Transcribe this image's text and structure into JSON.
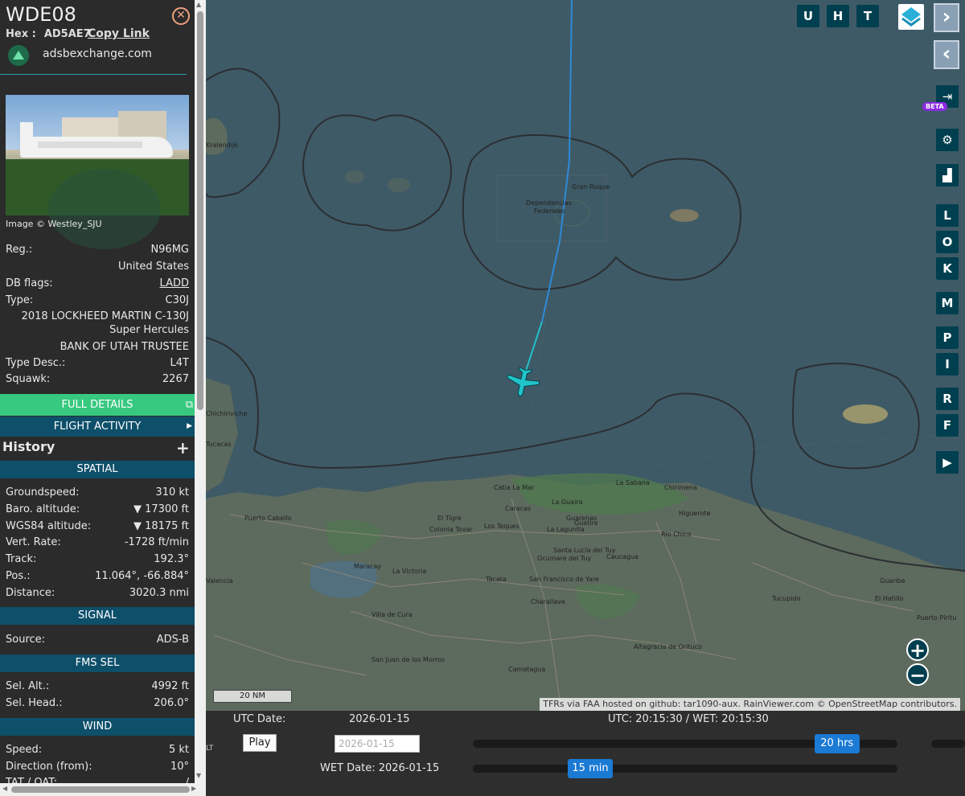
{
  "sidebar": {
    "callsign": "WDE08",
    "close_icon": "close-icon",
    "hex_label": "Hex :",
    "hex_value": "AD5AE7",
    "copy_link": "Copy Link",
    "site": "adsbexchange.com",
    "photo_caption": "Image © Westley_SJU",
    "reg_label": "Reg.:",
    "reg_value": "N96MG",
    "country": "United States",
    "dbflags_label": "DB flags:",
    "dbflags_value": "LADD",
    "type_label": "Type:",
    "type_value": "C30J",
    "type_line1": "2018 LOCKHEED MARTIN C-130J",
    "type_line2": "Super Hercules",
    "owner": "BANK OF UTAH TRUSTEE",
    "typedesc_label": "Type Desc.:",
    "typedesc_value": "L4T",
    "squawk_label": "Squawk:",
    "squawk_value": "2267",
    "full_details": "FULL DETAILS",
    "flight_activity": "FLIGHT ACTIVITY",
    "history": "History",
    "spatial_header": "SPATIAL",
    "groundspeed_label": "Groundspeed:",
    "groundspeed_value": "310 kt",
    "baro_label": "Baro. altitude:",
    "baro_value": "▼ 17300 ft",
    "wgs_label": "WGS84 altitude:",
    "wgs_value": "▼ 18175 ft",
    "vrate_label": "Vert. Rate:",
    "vrate_value": "-1728 ft/min",
    "track_label": "Track:",
    "track_value": "192.3°",
    "pos_label": "Pos.:",
    "pos_value": "11.064°, -66.884°",
    "distance_label": "Distance:",
    "distance_value": "3020.3 nmi",
    "signal_header": "SIGNAL",
    "source_label": "Source:",
    "source_value": "ADS-B",
    "fms_header": "FMS SEL",
    "selalt_label": "Sel. Alt.:",
    "selalt_value": "4992 ft",
    "selhead_label": "Sel. Head.:",
    "selhead_value": "206.0°",
    "wind_header": "WIND",
    "wspeed_label": "Speed:",
    "wspeed_value": "5 kt",
    "wdir_label": "Direction (from):",
    "wdir_value": "10°",
    "tat_label": "TAT / OAT:",
    "tat_value": "/"
  },
  "map": {
    "buttons_top": [
      "U",
      "H",
      "T"
    ],
    "side_letters": [
      "L",
      "O",
      "K",
      "M",
      "P",
      "I",
      "R",
      "F"
    ],
    "beta": "BETA",
    "scale": "20 NM",
    "attribution": "TFRs via FAA hosted on github: tar1090-aux. RainViewer.com © OpenStreetMap contributors.",
    "places": [
      {
        "name": "Kralendijk"
      },
      {
        "name": "Gran Roque"
      },
      {
        "name": "Dependencias"
      },
      {
        "name": "Federales"
      },
      {
        "name": "Chichiriviche"
      },
      {
        "name": "Catia La Mar"
      },
      {
        "name": "La Guaira"
      },
      {
        "name": "Caracas"
      },
      {
        "name": "Guarenas"
      },
      {
        "name": "Los Teques"
      },
      {
        "name": "Maracay"
      },
      {
        "name": "Valencia"
      },
      {
        "name": "La Victoria"
      },
      {
        "name": "Higuerote"
      },
      {
        "name": "Colonia Tovar"
      },
      {
        "name": "Villa de Cura"
      },
      {
        "name": "Altagracia de Orituco"
      },
      {
        "name": "Puerto Cabello"
      },
      {
        "name": "Tucacas"
      },
      {
        "name": "San Juan de los Morros"
      },
      {
        "name": "Camatagua"
      },
      {
        "name": "Santa Lucía del Tuy"
      },
      {
        "name": "Chirimena"
      },
      {
        "name": "La Sabana"
      },
      {
        "name": "Ocumare del Tuy"
      },
      {
        "name": "El Tigre"
      },
      {
        "name": "San Francisco de Yare"
      },
      {
        "name": "Charallave"
      },
      {
        "name": "Tácata"
      },
      {
        "name": "La Lagunita"
      },
      {
        "name": "Guatire"
      },
      {
        "name": "Caucagua"
      },
      {
        "name": "Río Chico"
      },
      {
        "name": "Guaribe"
      },
      {
        "name": "Tucupido"
      },
      {
        "name": "Puerto Píritu"
      },
      {
        "name": "El Hatillo"
      }
    ]
  },
  "timeline": {
    "utc_date_label": "UTC Date:",
    "utc_date_value": "2026-01-15",
    "utc_time": "UTC: 20:15:30 / WET: 20:15:30",
    "play": "Play",
    "date_input_value": "2026-01-15",
    "slider1_label": "20 hrs",
    "slider1_value": 0.9,
    "wet_date": "WET Date: 2026-01-15",
    "slider2_label": "15 min",
    "slider2_value": 0.25,
    "lt": "LT"
  }
}
